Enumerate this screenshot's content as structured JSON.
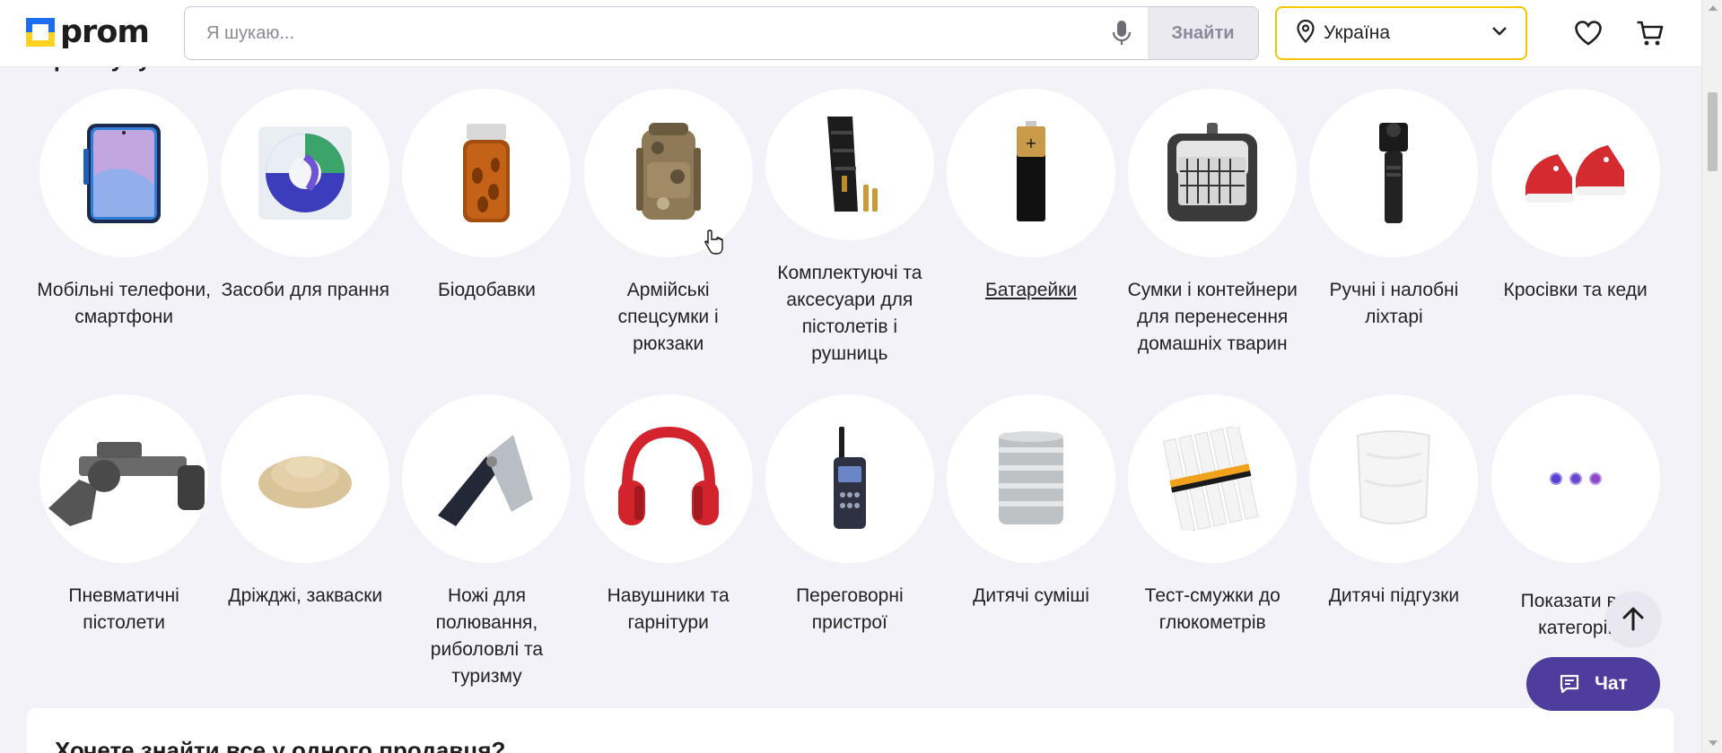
{
  "header": {
    "logo_text": "prom",
    "search_placeholder": "Я шукаю...",
    "search_button": "Знайти",
    "region": "Україна"
  },
  "section_title": "Зараз купують",
  "categories_row1": [
    {
      "label": "Мобільні телефони, смартфони"
    },
    {
      "label": "Засоби для прання"
    },
    {
      "label": "Біодобавки"
    },
    {
      "label": "Армійські спецсумки і рюкзаки"
    },
    {
      "label": "Комплектуючі та аксесуари для пістолетів і рушниць"
    },
    {
      "label": "Батарейки"
    },
    {
      "label": "Сумки і контейнери для перенесення домашніх тварин"
    },
    {
      "label": "Ручні і налобні ліхтарі"
    },
    {
      "label": "Кросівки та кеди"
    }
  ],
  "categories_row2": [
    {
      "label": "Пневматичні пістолети"
    },
    {
      "label": "Дріжджі, закваски"
    },
    {
      "label": "Ножі для полювання, риболовлі та туризму"
    },
    {
      "label": "Навушники та гарнітури"
    },
    {
      "label": "Переговорні пристрої"
    },
    {
      "label": "Дитячі суміші"
    },
    {
      "label": "Тест-смужки до глюкометрів"
    },
    {
      "label": "Дитячі підгузки"
    },
    {
      "label": "Показати всі категорії"
    }
  ],
  "bottom_card_title": "Хочете знайти все у одного продавця?",
  "chat_label": "Чат",
  "colors": {
    "accent": "#4e3d9d",
    "region_border": "#f2c600",
    "page_bg": "#f3f2f9"
  }
}
